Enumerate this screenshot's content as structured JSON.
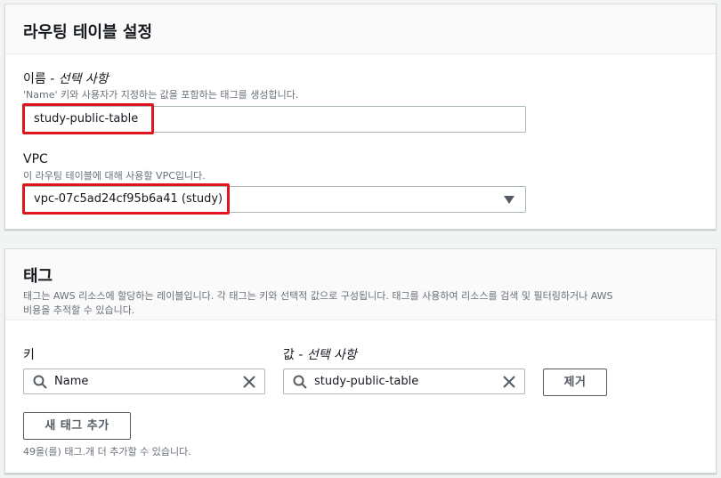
{
  "route_settings": {
    "title": "라우팅 테이블 설정",
    "name_label": "이름 - ",
    "name_optional": "선택 사항",
    "name_desc": "'Name' 키와 사용자가 지정하는 값을 포함하는 태그를 생성합니다.",
    "name_value": "study-public-table",
    "vpc_label": "VPC",
    "vpc_desc": "이 라우팅 테이블에 대해 사용할 VPC입니다.",
    "vpc_value": "vpc-07c5ad24cf95b6a41 (study)"
  },
  "tags": {
    "title": "태그",
    "desc_line1": "태그는 AWS 리소스에 할당하는 레이블입니다. 각 태그는 키와 선택적 값으로 구성됩니다. 태그를 사용하여 리소스를 검색 및 필터링하거나 AWS",
    "desc_line2": "비용을 추적할 수 있습니다.",
    "key_label": "키",
    "value_label": "값 - ",
    "value_optional": "선택 사항",
    "key_value": "Name",
    "value_value": "study-public-table",
    "remove_button": "제거",
    "add_button": "새 태그 추가",
    "remaining": "49을(를) 태그.개 더 추가할 수 있습니다."
  },
  "colors": {
    "highlight": "#e0161e",
    "border": "#aab7b8",
    "muted_text": "#687078"
  },
  "icons": [
    "search-icon",
    "clear-icon",
    "caret-down-icon"
  ]
}
